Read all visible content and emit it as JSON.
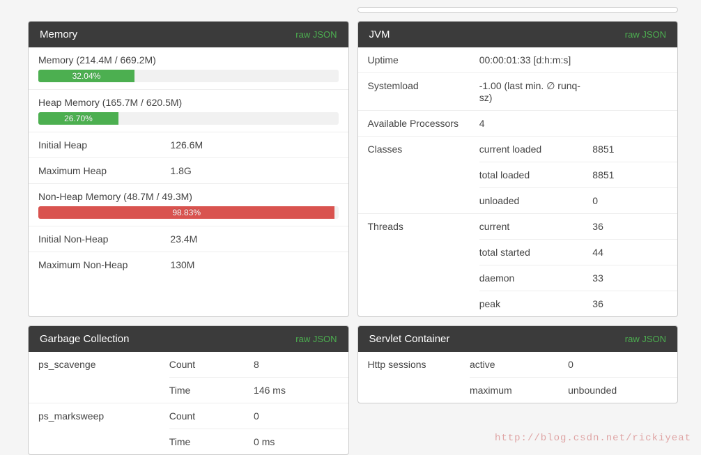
{
  "raw_label": "raw JSON",
  "memory": {
    "title": "Memory",
    "items": [
      {
        "label": "Memory (214.4M / 669.2M)",
        "pct": 32.04,
        "pct_text": "32.04%",
        "color": "green"
      },
      {
        "label": "Heap Memory (165.7M / 620.5M)",
        "pct": 26.7,
        "pct_text": "26.70%",
        "color": "green"
      },
      {
        "label": "Initial Heap",
        "value": "126.6M"
      },
      {
        "label": "Maximum Heap",
        "value": "1.8G"
      },
      {
        "label": "Non-Heap Memory (48.7M / 49.3M)",
        "pct": 98.83,
        "pct_text": "98.83%",
        "color": "red"
      },
      {
        "label": "Initial Non-Heap",
        "value": "23.4M"
      },
      {
        "label": "Maximum Non-Heap",
        "value": "130M"
      }
    ]
  },
  "jvm": {
    "title": "JVM",
    "rows": [
      {
        "key": "Uptime",
        "value": "00:00:01:33 [d:h:m:s]"
      },
      {
        "key": "Systemload",
        "value": "-1.00 (last min. ∅ runq-sz)"
      },
      {
        "key": "Available Processors",
        "value": "4"
      },
      {
        "key": "Classes",
        "sub": [
          {
            "k": "current loaded",
            "v": "8851"
          },
          {
            "k": "total loaded",
            "v": "8851"
          },
          {
            "k": "unloaded",
            "v": "0"
          }
        ]
      },
      {
        "key": "Threads",
        "sub": [
          {
            "k": "current",
            "v": "36"
          },
          {
            "k": "total started",
            "v": "44"
          },
          {
            "k": "daemon",
            "v": "33"
          },
          {
            "k": "peak",
            "v": "36"
          }
        ]
      }
    ]
  },
  "gc": {
    "title": "Garbage Collection",
    "rows": [
      {
        "key": "ps_scavenge",
        "sub": [
          {
            "k": "Count",
            "v": "8"
          },
          {
            "k": "Time",
            "v": "146 ms"
          }
        ]
      },
      {
        "key": "ps_marksweep",
        "sub": [
          {
            "k": "Count",
            "v": "0"
          },
          {
            "k": "Time",
            "v": "0 ms"
          }
        ]
      }
    ]
  },
  "servlet": {
    "title": "Servlet Container",
    "rows": [
      {
        "key": "Http sessions",
        "sub": [
          {
            "k": "active",
            "v": "0"
          },
          {
            "k": "maximum",
            "v": "unbounded"
          }
        ]
      }
    ]
  },
  "watermark": "http://blog.csdn.net/rickiyeat"
}
